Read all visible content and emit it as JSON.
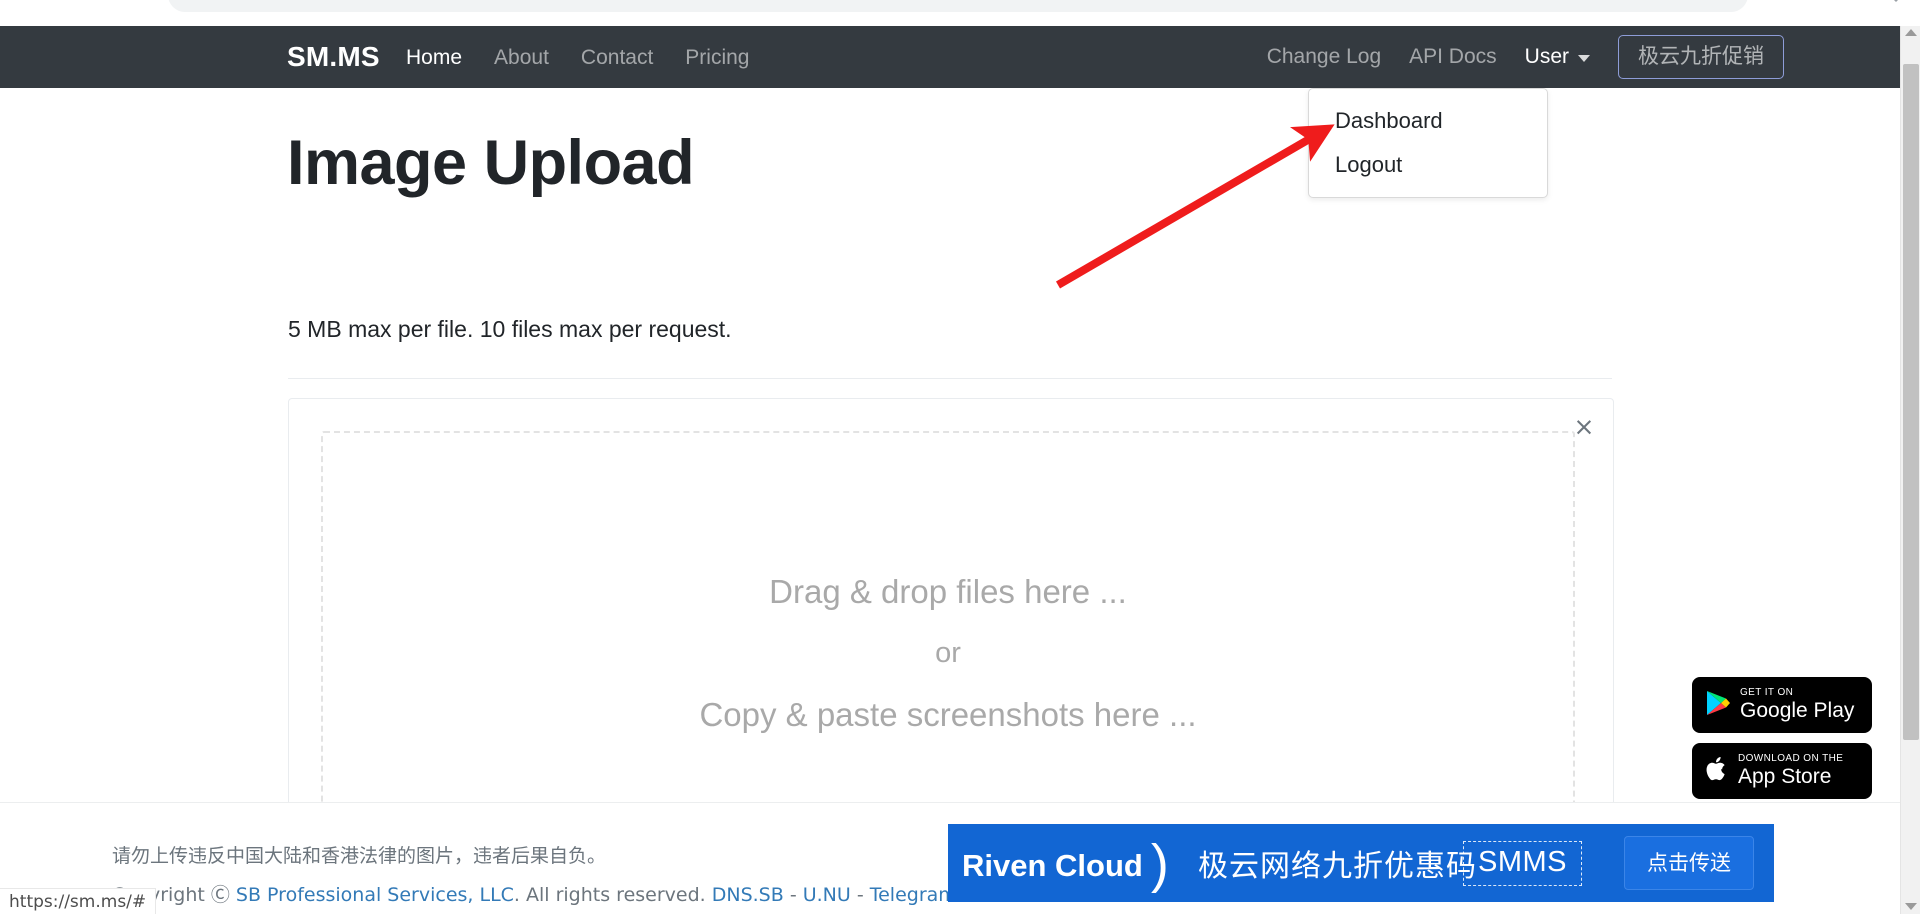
{
  "browser": {
    "status_url": "https://sm.ms/#"
  },
  "navbar": {
    "brand": "SM.MS",
    "left_links": [
      {
        "label": "Home",
        "active": true
      },
      {
        "label": "About",
        "active": false
      },
      {
        "label": "Contact",
        "active": false
      },
      {
        "label": "Pricing",
        "active": false
      }
    ],
    "right_links": [
      {
        "label": "Change Log"
      },
      {
        "label": "API Docs"
      }
    ],
    "user_label": "User",
    "caret_icon": "chevron-down-icon",
    "promo_button": "极云九折促销",
    "bg_color": "#343a40",
    "promo_border_color": "#8e9dd8"
  },
  "dropdown": {
    "open": true,
    "items": [
      {
        "label": "Dashboard"
      },
      {
        "label": "Logout"
      }
    ]
  },
  "main": {
    "title": "Image Upload",
    "subtitle": "5 MB max per file. 10 files max per request.",
    "close_icon": "close-icon",
    "close_label": "×",
    "dropzone": {
      "line1": "Drag & drop files here ...",
      "line2": "or",
      "line3": "Copy & paste screenshots here ..."
    }
  },
  "app_badges": [
    {
      "small": "GET IT ON",
      "big": "Google Play",
      "icon": "google-play-icon"
    },
    {
      "small": "Download on the",
      "big": "App Store",
      "icon": "apple-icon"
    }
  ],
  "footer": {
    "notice": "请勿上传违反中国大陆和香港法律的图片，违者后果自负。",
    "copyright_prefix": "Copyright Ⓒ ",
    "company": "SB Professional Services, LLC",
    "rights": ". All rights reserved. ",
    "links": [
      {
        "label": "DNS.SB"
      },
      {
        "label": "U.NU"
      },
      {
        "label": "Telegram"
      }
    ],
    "separator": " - ",
    "link_color": "#337ab7"
  },
  "ad": {
    "logo": "Riven Cloud",
    "logo_mark": ")",
    "slogan": "极云网络九折优惠码",
    "code": "SMMS",
    "cta": "点击传送",
    "bg_color": "#1266d3"
  },
  "annotation": {
    "arrow_color": "#ef1c1c",
    "points_to": "Dashboard"
  }
}
